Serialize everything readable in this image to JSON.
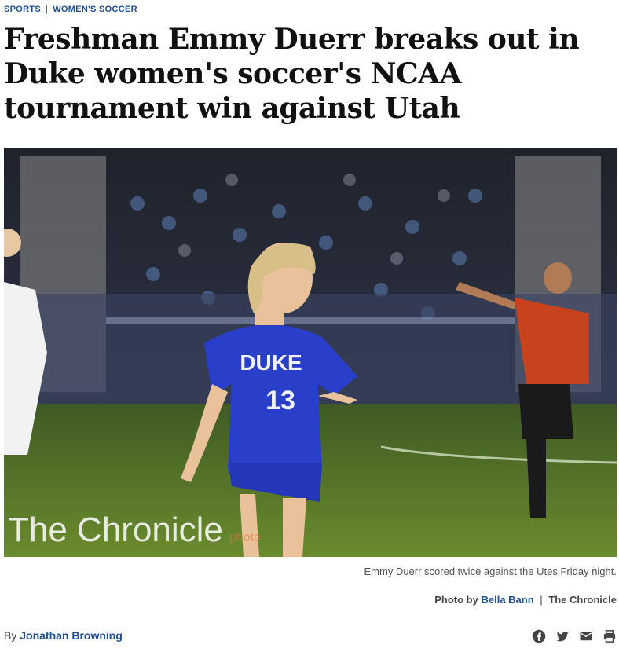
{
  "breadcrumb": {
    "section": "SPORTS",
    "separator": "|",
    "subsection": "WOMEN'S SOCCER"
  },
  "headline": "Freshman Emmy Duerr breaks out in Duke women's soccer's NCAA tournament win against Utah",
  "photo": {
    "jersey_text": "DUKE",
    "jersey_number": "13",
    "watermark": "The Chronicle",
    "watermark_suffix": "photo"
  },
  "caption": "Emmy Duerr scored twice against the Utes Friday night.",
  "credit": {
    "prefix": "Photo by",
    "photographer": "Bella Bann",
    "separator": "|",
    "outlet": "The Chronicle"
  },
  "byline": {
    "prefix": "By",
    "author": "Jonathan Browning"
  },
  "share_icons": [
    "facebook-icon",
    "twitter-icon",
    "email-icon",
    "print-icon"
  ],
  "colors": {
    "link": "#1f4e99",
    "duke_blue": "#2a3fc9",
    "referee_red": "#c8421e"
  }
}
